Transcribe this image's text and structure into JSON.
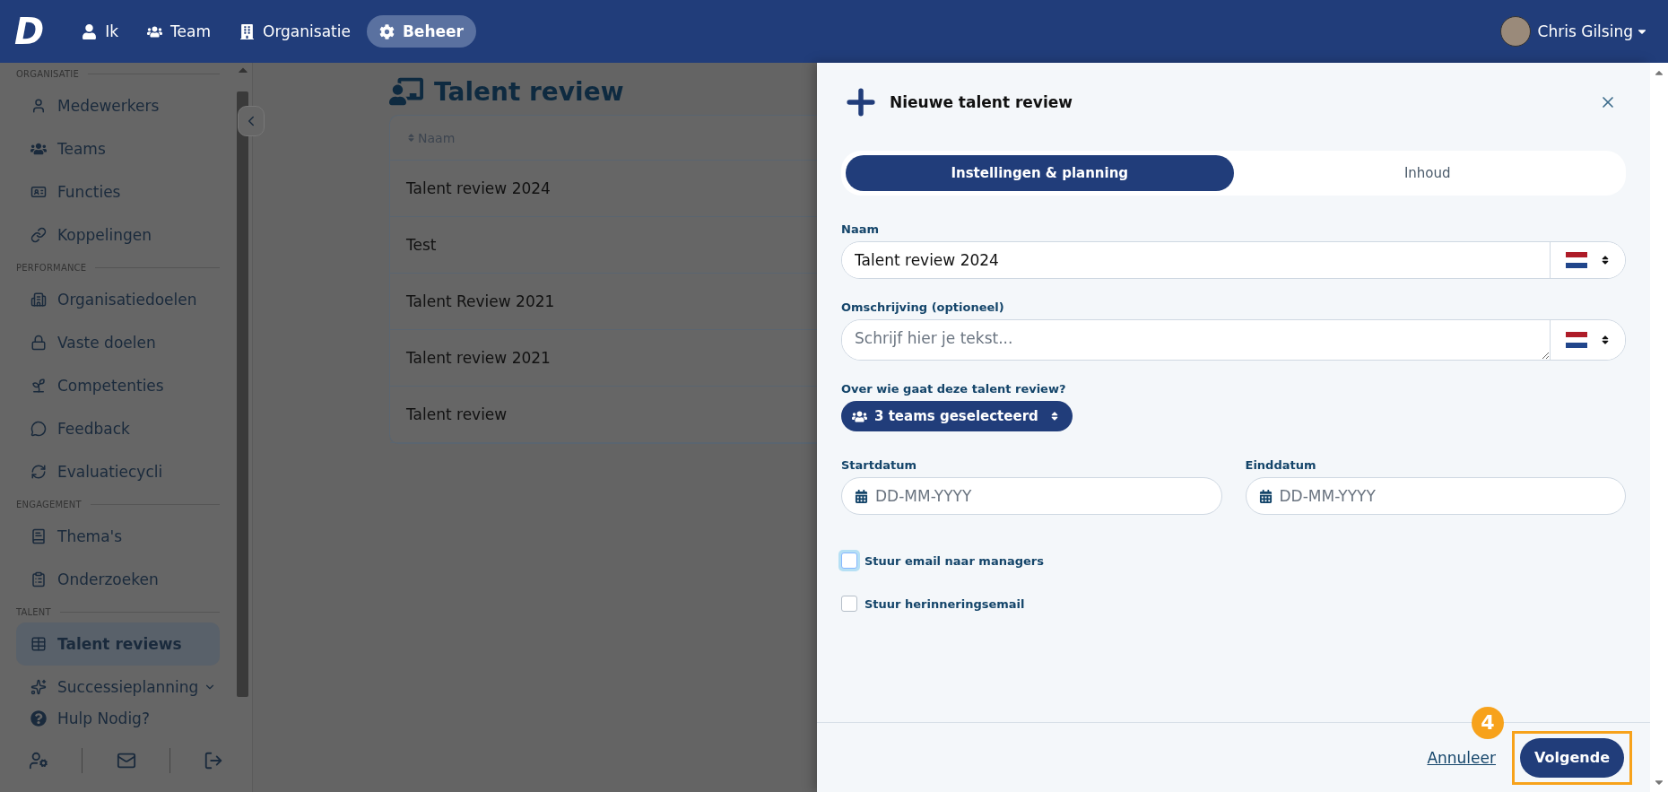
{
  "navbar": {
    "logo": "D",
    "items": [
      {
        "label": "Ik",
        "selected": false
      },
      {
        "label": "Team",
        "selected": false
      },
      {
        "label": "Organisatie",
        "selected": false
      },
      {
        "label": "Beheer",
        "selected": true
      }
    ],
    "user": {
      "name": "Chris Gilsing"
    }
  },
  "sidebar": {
    "sections": [
      {
        "title": "ORGANISATIE",
        "items": [
          {
            "label": "Medewerkers",
            "selected": false,
            "expandable": false
          },
          {
            "label": "Teams",
            "selected": false,
            "expandable": false
          },
          {
            "label": "Functies",
            "selected": false,
            "expandable": false
          },
          {
            "label": "Koppelingen",
            "selected": false,
            "expandable": false
          }
        ]
      },
      {
        "title": "PERFORMANCE",
        "items": [
          {
            "label": "Organisatiedoelen",
            "selected": false,
            "expandable": false
          },
          {
            "label": "Vaste doelen",
            "selected": false,
            "expandable": false
          },
          {
            "label": "Competenties",
            "selected": false,
            "expandable": false
          },
          {
            "label": "Feedback",
            "selected": false,
            "expandable": false
          },
          {
            "label": "Evaluatiecycli",
            "selected": false,
            "expandable": false
          }
        ]
      },
      {
        "title": "ENGAGEMENT",
        "items": [
          {
            "label": "Thema's",
            "selected": false,
            "expandable": false
          },
          {
            "label": "Onderzoeken",
            "selected": false,
            "expandable": false
          }
        ]
      },
      {
        "title": "TALENT",
        "items": [
          {
            "label": "Talent reviews",
            "selected": true,
            "expandable": false
          },
          {
            "label": "Successieplanning",
            "selected": false,
            "expandable": true
          }
        ]
      }
    ],
    "help": "Hulp Nodig?"
  },
  "page": {
    "title": "Talent review",
    "table": {
      "columns": [
        "Naam"
      ],
      "rows": [
        [
          "Talent review 2024"
        ],
        [
          "Test"
        ],
        [
          "Talent Review 2021"
        ],
        [
          "Talent review 2021"
        ],
        [
          "Talent review"
        ]
      ]
    }
  },
  "modal": {
    "title": "Nieuwe talent review",
    "tabs": [
      {
        "label": "Instellingen & planning",
        "selected": true
      },
      {
        "label": "Inhoud",
        "selected": false
      }
    ],
    "fields": [
      {
        "kind": "text",
        "label": "Naam",
        "value": "Talent review 2024"
      },
      {
        "kind": "textarea",
        "label": "Omschrijving (optioneel)",
        "placeholder": "Schrijf hier je tekst..."
      }
    ],
    "audience": {
      "label": "Over wie gaat deze talent review?",
      "value": "3 teams geselecteerd"
    },
    "dates": [
      {
        "label": "Startdatum",
        "placeholder": "DD-MM-YYYY"
      },
      {
        "label": "Einddatum",
        "placeholder": "DD-MM-YYYY"
      }
    ],
    "checkboxes": [
      {
        "label": "Stuur email naar managers",
        "checked": false,
        "focused": true
      },
      {
        "label": "Stuur herinneringsemail",
        "checked": false,
        "focused": false
      }
    ],
    "footer": {
      "cancel": "Annuleer",
      "next": "Volgende",
      "step_badge": "4"
    }
  }
}
